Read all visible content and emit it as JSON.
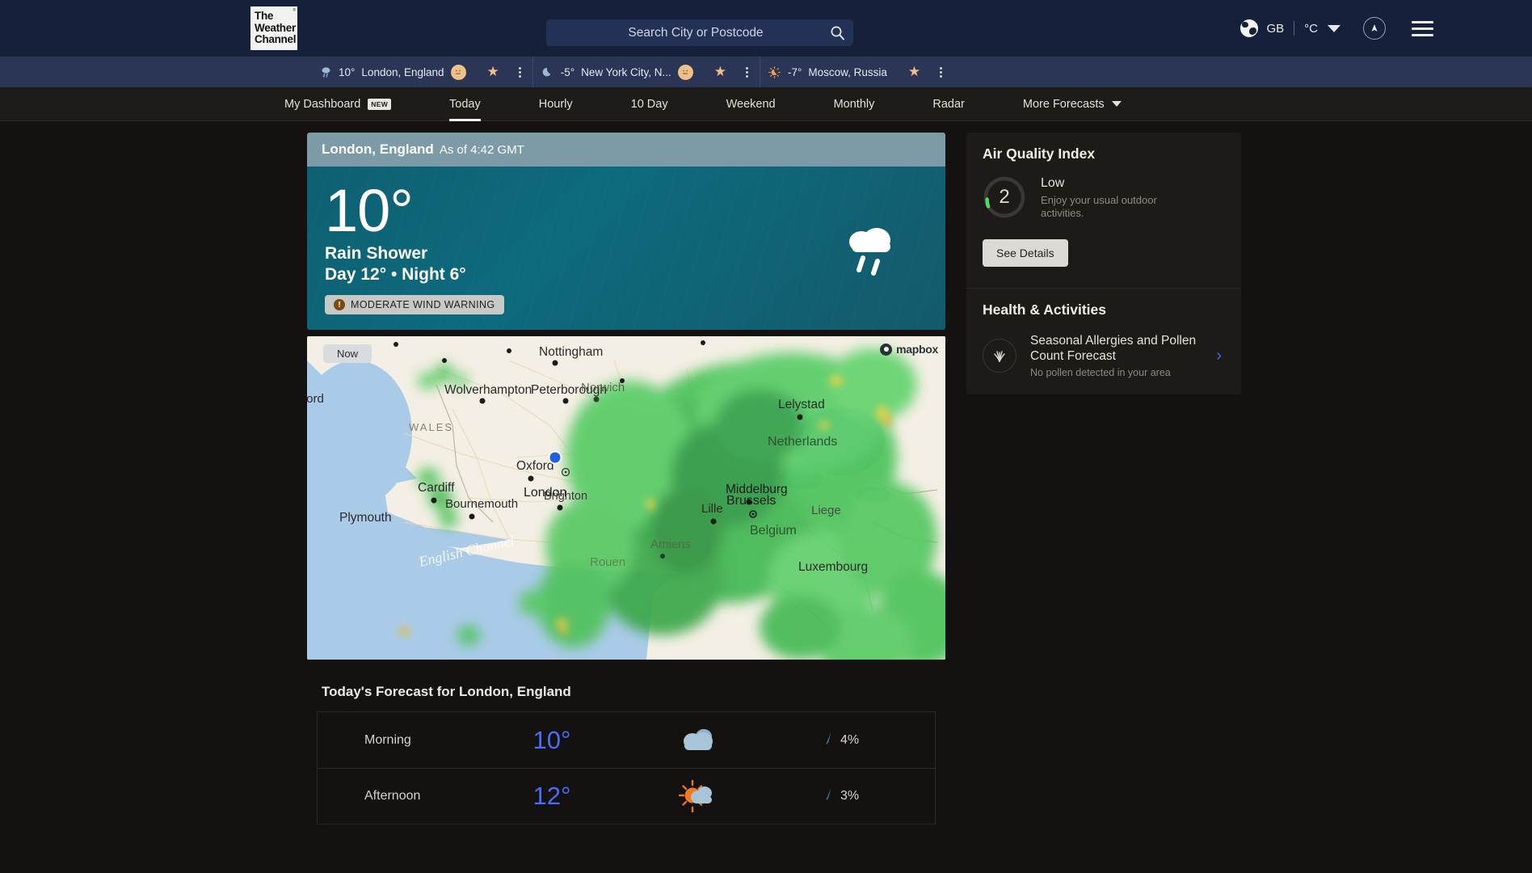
{
  "header": {
    "logo": {
      "line1": "The",
      "line2": "Weather",
      "line3": "Channel",
      "reg": "®"
    },
    "search": {
      "placeholder": "Search City or Postcode",
      "value": "",
      "icon": "search-icon"
    },
    "region": "GB",
    "unit": "°C",
    "globe_icon": "globe-icon",
    "avatar_icon": "avatar-icon",
    "menu_icon": "hamburger-menu-icon"
  },
  "city_tabs": [
    {
      "icon": "rain-drop-icon",
      "temp": "10°",
      "name": "London, England",
      "face": "face-icon",
      "star": "★",
      "menu": "kebab-menu-icon"
    },
    {
      "icon": "moon-icon",
      "temp": "-5°",
      "name": "New York City, N...",
      "face": "face-icon",
      "star": "★",
      "menu": "kebab-menu-icon"
    },
    {
      "icon": "sun-moon-icon",
      "temp": "-7°",
      "name": "Moscow, Russia",
      "face": null,
      "star": "★",
      "menu": "kebab-menu-icon"
    }
  ],
  "nav": {
    "items": [
      {
        "label": "My Dashboard",
        "badge": "NEW",
        "active": false
      },
      {
        "label": "Today",
        "badge": null,
        "active": true
      },
      {
        "label": "Hourly",
        "badge": null,
        "active": false
      },
      {
        "label": "10 Day",
        "badge": null,
        "active": false
      },
      {
        "label": "Weekend",
        "badge": null,
        "active": false
      },
      {
        "label": "Monthly",
        "badge": null,
        "active": false
      },
      {
        "label": "Radar",
        "badge": null,
        "active": false
      },
      {
        "label": "More Forecasts",
        "badge": null,
        "active": false,
        "caret": true
      }
    ]
  },
  "hero": {
    "city": "London, England",
    "as_of": "As of 4:42 GMT",
    "temperature": "10°",
    "condition": "Rain Shower",
    "day_night": "Day 12° • Night 6°",
    "warning": "MODERATE WIND WARNING",
    "warning_icon": "alert-exclamation-icon",
    "weather_icon": "rain-shower-icon"
  },
  "radar": {
    "now_label": "Now",
    "attribution": "mapbox",
    "attribution_icon": "mapbox-logo-icon",
    "location_marker": "current-location-marker",
    "labels": [
      "Nottingham",
      "Wolverhampton",
      "Peterborough",
      "Norwich",
      "Lelystad",
      "WALES",
      "Oxford",
      "Cardiff",
      "London",
      "Middelburg",
      "Netherlands",
      "Bournemouth",
      "Brighton",
      "Brussels",
      "Lille",
      "Liege",
      "Belgium",
      "Plymouth",
      "English Channel",
      "Rouen",
      "Amiens",
      "Luxembourg",
      "ford"
    ]
  },
  "forecast": {
    "title": "Today's Forecast for London, England",
    "rows": [
      {
        "when": "Morning",
        "temp": "10°",
        "icon": "cloudy-icon",
        "pop": "4%",
        "pop_icon": "precip-drop-icon"
      },
      {
        "when": "Afternoon",
        "temp": "12°",
        "icon": "sun-behind-cloud-icon",
        "pop": "3%",
        "pop_icon": "precip-drop-icon"
      }
    ]
  },
  "air_quality": {
    "title": "Air Quality Index",
    "value": "2",
    "category": "Low",
    "description": "Enjoy your usual outdoor activities.",
    "button": "See Details",
    "accent_color": "#4cd964"
  },
  "health": {
    "title": "Health & Activities",
    "item_title": "Seasonal Allergies and Pollen Count Forecast",
    "item_sub": "No pollen detected in your area",
    "item_icon": "pollen-grass-icon",
    "chevron": "chevron-right-icon"
  }
}
